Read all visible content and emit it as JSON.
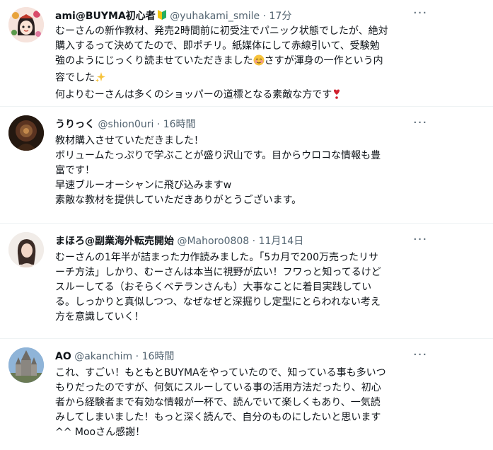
{
  "tweets": [
    {
      "name": "ami@BUYMA初心者",
      "handle": "@yuhakami_smile",
      "dot": "·",
      "time": "17分",
      "lines": [
        "むーさんの新作教材、発売2時間前に初受注でパニック状態でしたが、絶対",
        "購入するって決めてたので、即ポチリ。紙媒体にして赤線引いて、受験勉",
        "強のようにじっくり読ませていただきました",
        "さすが渾身の一作という内",
        "容でした",
        "何よりむーさんは多くのショッパーの道標となる素敵な方です"
      ]
    },
    {
      "name": "うりっく",
      "handle": "@shion0uri",
      "dot": "·",
      "time": "16時間",
      "lines": [
        "教材購入させていただきました！",
        "ボリュームたっぷりで学ぶことが盛り沢山です。目からウロコな情報も豊",
        "富です！",
        "早速ブルーオーシャンに飛び込みますw",
        "素敵な教材を提供していただきありがとうございます。"
      ]
    },
    {
      "name": "まほろ@副業海外転売開始",
      "handle": "@Mahoro0808",
      "dot": "·",
      "time": "11月14日",
      "lines": [
        "むーさんの1年半が詰まった力作読みました。「5カ月で200万売ったリサ",
        "ーチ方法」しかり、むーさんは本当に視野が広い！フワっと知ってるけど",
        "スルーしてる（おそらくベテランさんも）大事なことに着目実践してい",
        "る。しっかりと真似しつつ、なぜなぜと深掘りし定型にとらわれない考え",
        "方を意識していく！"
      ]
    },
    {
      "name": "AO",
      "handle": "@akanchim",
      "dot": "·",
      "time": "16時間",
      "lines": [
        "これ、すごい！もともとBUYMAをやっていたので、知っている事も多いつ",
        "もりだったのですが、何気にスルーしている事の活用方法だったり、初心",
        "者から経験者まで有効な情報が一杯で、読んでいて楽しくもあり、一気読",
        "みしてしまいました！もっと深く読んで、自分のものにしたいと思います",
        "^^ Mooさん感謝！"
      ]
    }
  ],
  "more_label": "···",
  "colors": {
    "secondary": "#536471",
    "text": "#0f1419",
    "separator": "#eff3f4"
  }
}
